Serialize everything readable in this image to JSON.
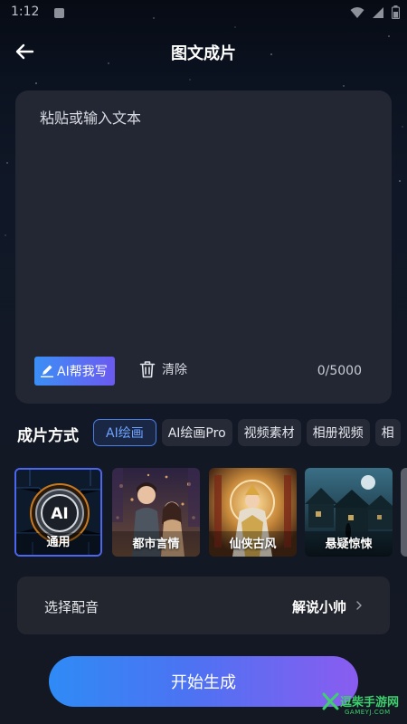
{
  "status_bar": {
    "time": "1:12",
    "icons": [
      "notification-square-icon",
      "wifi-icon",
      "cellular-signal-icon",
      "battery-icon"
    ]
  },
  "header": {
    "back_icon": "arrow-left-icon",
    "title": "图文成片"
  },
  "text_editor": {
    "placeholder": "粘贴或输入文本",
    "value": "",
    "ai_write_label": "AI帮我写",
    "ai_write_icon": "pencil-icon",
    "clear_label": "清除",
    "clear_icon": "trash-icon",
    "char_count": "0/5000"
  },
  "mode": {
    "label": "成片方式",
    "tabs": [
      {
        "label": "AI绘画",
        "active": true
      },
      {
        "label": "AI绘画Pro",
        "active": false
      },
      {
        "label": "视频素材",
        "active": false
      },
      {
        "label": "相册视频",
        "active": false
      },
      {
        "label": "相",
        "active": false
      }
    ]
  },
  "styles": [
    {
      "label": "通用",
      "selected": true,
      "badge": "AI"
    },
    {
      "label": "都市言情",
      "selected": false
    },
    {
      "label": "仙侠古风",
      "selected": false
    },
    {
      "label": "悬疑惊悚",
      "selected": false
    }
  ],
  "voice": {
    "label": "选择配音",
    "value": "解说小帅",
    "icon": "chevron-right-icon"
  },
  "start_button": {
    "label": "开始生成"
  },
  "watermark": {
    "text": "逗柴手游网",
    "sub": "GAMEYJ.COM"
  },
  "colors": {
    "accent_blue": "#3a8ff5",
    "accent_purple": "#8a5cf0",
    "active_tab_text": "#6fa3ff",
    "card_bg": "#252935",
    "page_bg": "#131823"
  }
}
